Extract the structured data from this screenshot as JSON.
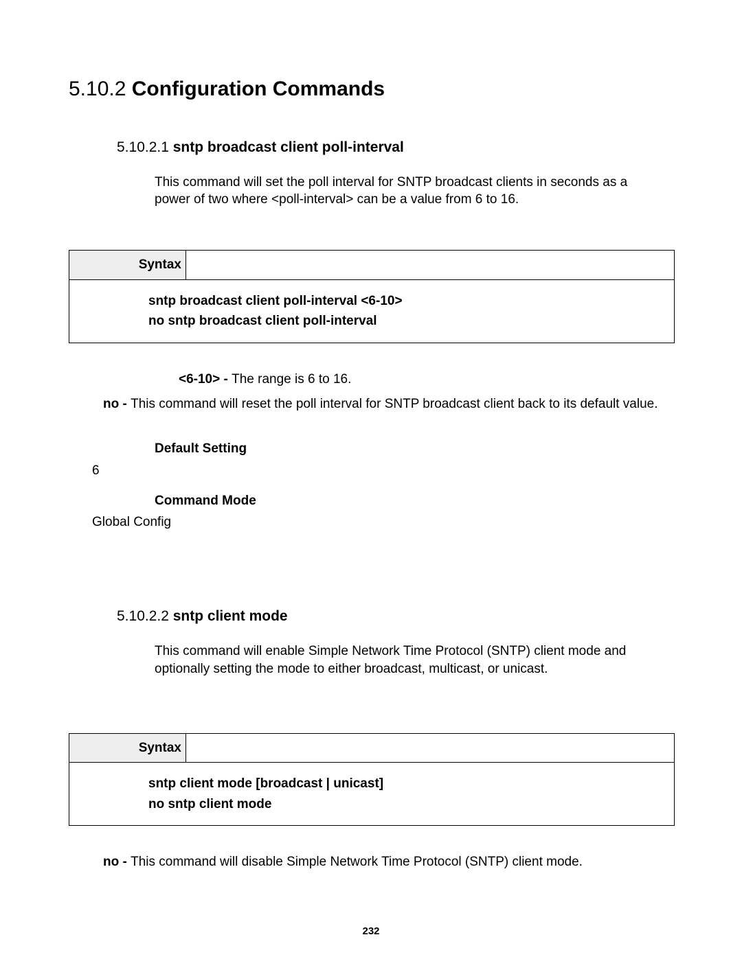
{
  "section": {
    "number": "5.10.2",
    "title": "Configuration Commands"
  },
  "sub1": {
    "number": "5.10.2.1",
    "title": "sntp broadcast client poll-interval",
    "desc": "This command will set the poll interval for SNTP broadcast clients in seconds as a power of two where <poll-interval> can be a value from 6 to 16.",
    "syntax_label": "Syntax",
    "syntax_line1": "sntp broadcast client poll-interval <6-10>",
    "syntax_line2": "no sntp broadcast client poll-interval",
    "param_label": "<6-10> - ",
    "param_text": "The range is 6 to 16.",
    "no_label": "no - ",
    "no_text": "This command will reset the poll interval for SNTP broadcast client back to its default value.",
    "default_label": "Default Setting",
    "default_value": "6",
    "mode_label": "Command Mode",
    "mode_value": "Global Config"
  },
  "sub2": {
    "number": "5.10.2.2",
    "title": "sntp client mode",
    "desc": "This command will enable Simple Network Time Protocol (SNTP) client mode and optionally setting the mode to either broadcast, multicast, or unicast.",
    "syntax_label": "Syntax",
    "syntax_line1": "sntp client mode [broadcast | unicast]",
    "syntax_line2": "no sntp client mode",
    "no_label": "no - ",
    "no_text": "This command will disable Simple Network Time Protocol (SNTP) client mode."
  },
  "page_number": "232"
}
